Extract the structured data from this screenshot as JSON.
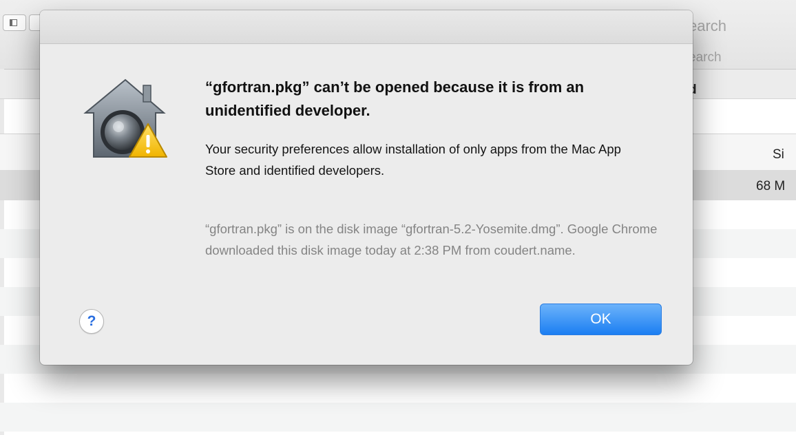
{
  "background_window": {
    "search_label_top": "earch",
    "search_label_bottom": "earch",
    "header_fragment": "d",
    "size_column_header": "Si",
    "selected_row_size": "68 M"
  },
  "dialog": {
    "title": "“gfortran.pkg” can’t be opened because it is from an unidentified developer.",
    "message": "Your security preferences allow installation of only apps from the Mac App Store and identified developers.",
    "info": "“gfortran.pkg” is on the disk image “gfortran-5.2-Yosemite.dmg”. Google Chrome downloaded this disk image today at 2:38 PM from coudert.name.",
    "help_label": "?",
    "ok_label": "OK",
    "icon": "gatekeeper-warning-icon"
  },
  "colors": {
    "ok_button": "#1b7ef2",
    "help_glyph": "#2b6fe0",
    "warning": "#f5c518"
  }
}
